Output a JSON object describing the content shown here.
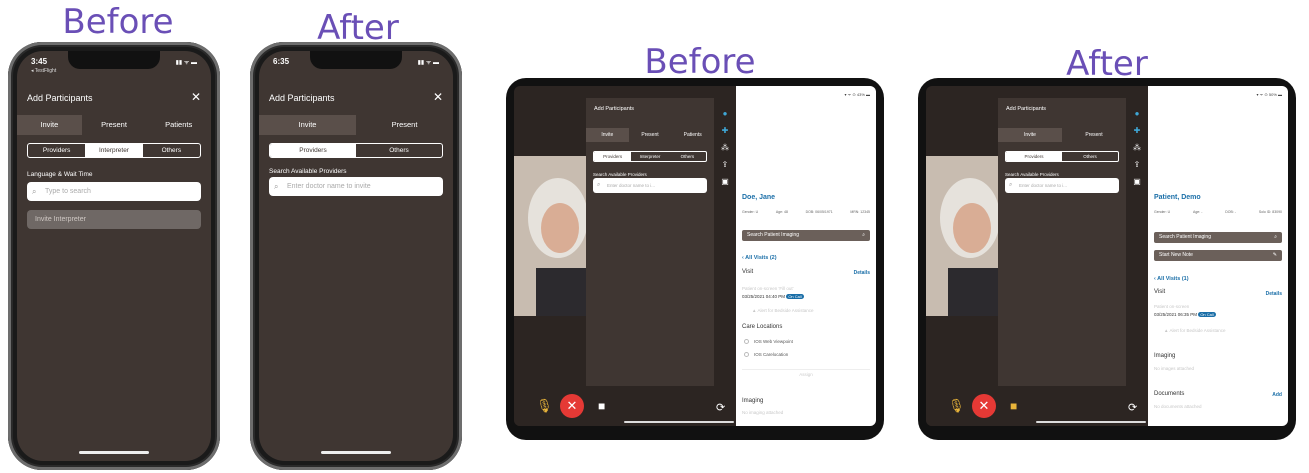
{
  "captions": {
    "phone_before": "Before",
    "phone_after": "After",
    "tablet_before": "Before",
    "tablet_after": "After"
  },
  "phone_before": {
    "time": "3:45",
    "sub_status": "◂ TestFlight",
    "status_right": "▮▮ ᯤ ▬",
    "title": "Add Participants",
    "close_icon": "✕",
    "tabs": [
      "Invite",
      "Present",
      "Patients"
    ],
    "segments": [
      "Providers",
      "Interpreter",
      "Others"
    ],
    "selected_segment": "Interpreter",
    "field_label": "Language & Wait Time",
    "search_placeholder": "Type to search",
    "invite_button": "Invite Interpreter"
  },
  "phone_after": {
    "time": "6:35",
    "status_right": "▮▮ ᯤ ▬",
    "title": "Add Participants",
    "close_icon": "✕",
    "tabs": [
      "Invite",
      "Present"
    ],
    "segments": [
      "Providers",
      "Others"
    ],
    "selected_segment": "Providers",
    "field_label": "Search Available Providers",
    "search_placeholder": "Enter doctor name to invite"
  },
  "tablet_before": {
    "status": "▾ ᯤ ⊙ 43% ▬",
    "panel_title": "Add Participants",
    "tabs": [
      "Invite",
      "Present",
      "Patients"
    ],
    "segments": [
      "Providers",
      "Interpreter",
      "Others"
    ],
    "selected_segment": "Providers",
    "field_label": "Search Available Providers",
    "search_placeholder": "Enter doctor name to i...",
    "patient_name": "Doe, Jane",
    "meta": [
      "Gender: U",
      "Age: 48",
      "DOB: 06/05/1971",
      "MRN: 12345"
    ],
    "search_imaging": "Search Patient Imaging",
    "all_visits": "All Visits (2)",
    "visit_label": "Visit",
    "details_link": "Details",
    "visit_reason": "Patient on-screen 'Fill out'",
    "visit_time": "03/25/2021 04:40 PM",
    "badge": "On Call",
    "alert_text": "Alert for Bedside Assistance",
    "care_locations": "Care Locations",
    "locations": [
      "IOS Web Viewpoint",
      "IOS Carelocation"
    ],
    "assign": "Assign",
    "imaging": "Imaging",
    "imaging_note": "No imaging attached"
  },
  "tablet_after": {
    "status": "▾ ᯤ ⊙ 50% ▬",
    "panel_title": "Add Participants",
    "tabs": [
      "Invite",
      "Present"
    ],
    "segments": [
      "Providers",
      "Others"
    ],
    "selected_segment": "Providers",
    "field_label": "Search Available Providers",
    "search_placeholder": "Enter doctor name to i...",
    "patient_name": "Patient, Demo",
    "meta": [
      "Gender: U",
      "Age: -",
      "DOB: -",
      "Solo ID: 83090"
    ],
    "search_imaging": "Search Patient Imaging",
    "start_note": "Start New Note",
    "all_visits": "All Visits (1)",
    "visit_label": "Visit",
    "details_link": "Details",
    "visit_reason": "Patient on-screen",
    "visit_time": "03/25/2021 06:35 PM",
    "badge": "On Call",
    "alert_text": "Alert for Bedside Assistance",
    "imaging": "Imaging",
    "imaging_note": "No images attached",
    "documents": "Documents",
    "documents_note": "No documents attached",
    "add_link": "Add"
  },
  "icons": {
    "search": "⌕",
    "mic_off": "🎙",
    "end_call": "✕",
    "camera": "■",
    "flip_camera": "⟳",
    "pencil": "✎",
    "chevron_left": "‹",
    "person": "●",
    "add_person": "✚",
    "group": "⁂",
    "share": "⇪",
    "chat": "▣",
    "alert": "▲"
  },
  "colors": {
    "panel": "#3f3632",
    "accent": "#1b6fa8",
    "end_call": "#e53935",
    "mic_muted": "#e8b43a",
    "caption": "#6a4fb6"
  }
}
